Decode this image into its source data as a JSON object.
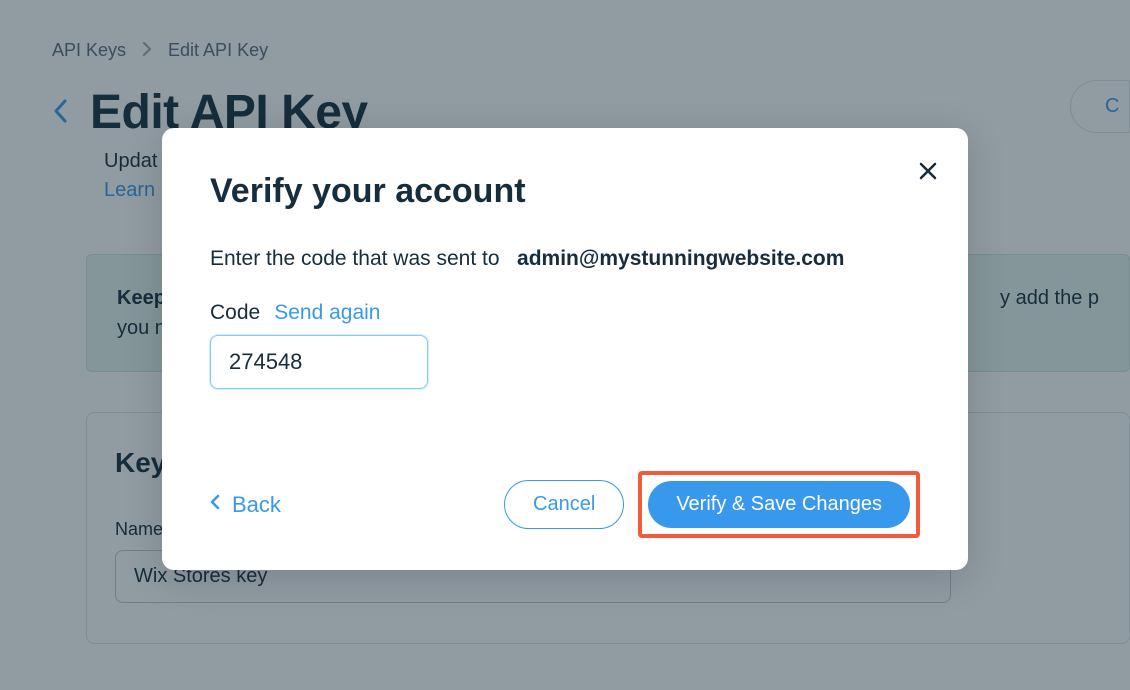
{
  "breadcrumb": {
    "root": "API Keys",
    "current": "Edit API Key"
  },
  "page": {
    "title": "Edit API Key",
    "subtitle_prefix": "Updat",
    "learn_text": "Learn",
    "top_right_button": "C"
  },
  "info_box": {
    "strong": "Keep in",
    "text_tail": "y add the p",
    "line2_prefix": "you nee"
  },
  "card": {
    "title": "Key de",
    "name_label": "Name",
    "name_value": "Wix Stores key"
  },
  "modal": {
    "title": "Verify your account",
    "subtitle_prefix": "Enter the code that was sent to",
    "email": "admin@mystunningwebsite.com",
    "code_label": "Code",
    "send_again": "Send again",
    "code_value": "274548",
    "back": "Back",
    "cancel": "Cancel",
    "verify": "Verify & Save Changes"
  }
}
